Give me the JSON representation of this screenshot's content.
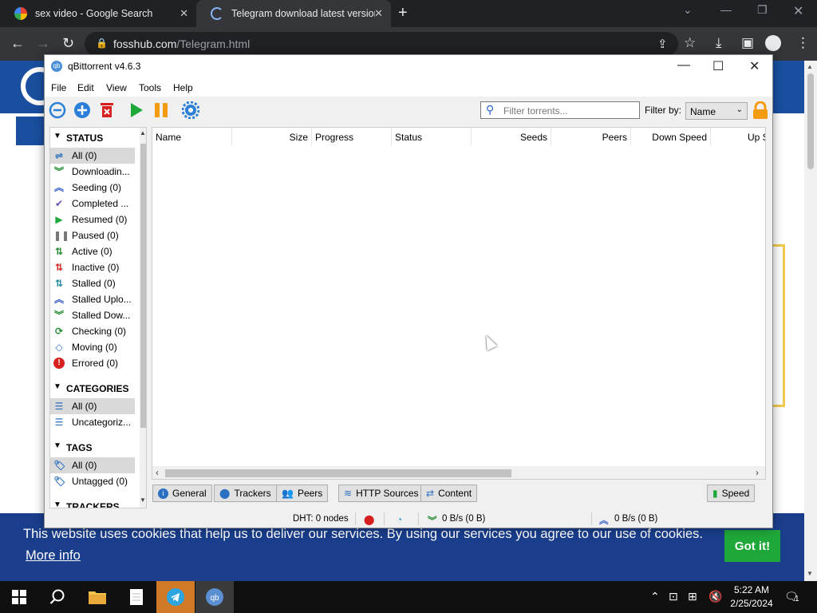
{
  "browser": {
    "tabs": [
      {
        "title": "sex video - Google Search",
        "favicon": "google-icon"
      },
      {
        "title": "Telegram download latest version",
        "favicon": "loading-icon"
      }
    ],
    "url_domain": "fosshub.com",
    "url_path": "/Telegram.html"
  },
  "webpage": {
    "cookie_message": "This website uses cookies that help us to deliver our services. By using our services you agree to our use of cookies.",
    "more_info": "More info",
    "got_it": "Got it!",
    "colors": {
      "header": "#1a4fa0",
      "banner": "#1a3e8c",
      "button": "#1fa83a"
    }
  },
  "qbittorrent": {
    "title": "qBittorrent v4.6.3",
    "menu": [
      "File",
      "Edit",
      "View",
      "Tools",
      "Help"
    ],
    "toolbar": {
      "buttons": [
        "add-link-icon",
        "add-torrent-icon",
        "delete-icon",
        "resume-icon",
        "pause-icon",
        "options-icon"
      ],
      "filter_placeholder": "Filter torrents...",
      "filter_by_label": "Filter by:",
      "filter_by_value": "Name"
    },
    "sidebar": {
      "status_header": "STATUS",
      "status_items": [
        {
          "label": "All (0)",
          "icon": "all-icon",
          "color": "#2b6fc2"
        },
        {
          "label": "Downloadin...",
          "icon": "downloading-icon",
          "color": "#1f8a2e"
        },
        {
          "label": "Seeding (0)",
          "icon": "seeding-icon",
          "color": "#3b63c7"
        },
        {
          "label": "Completed ...",
          "icon": "completed-icon",
          "color": "#6a4bb5"
        },
        {
          "label": "Resumed (0)",
          "icon": "resumed-icon",
          "color": "#1fa83a"
        },
        {
          "label": "Paused (0)",
          "icon": "paused-icon",
          "color": "#777777"
        },
        {
          "label": "Active (0)",
          "icon": "active-icon",
          "color": "#1f8a2e"
        },
        {
          "label": "Inactive (0)",
          "icon": "inactive-icon",
          "color": "#d62020"
        },
        {
          "label": "Stalled (0)",
          "icon": "stalled-icon",
          "color": "#1f8aa0"
        },
        {
          "label": "Stalled Uplo...",
          "icon": "stalled-upload-icon",
          "color": "#3b63c7"
        },
        {
          "label": "Stalled Dow...",
          "icon": "stalled-download-icon",
          "color": "#1f8a2e"
        },
        {
          "label": "Checking (0)",
          "icon": "checking-icon",
          "color": "#1f8a2e"
        },
        {
          "label": "Moving (0)",
          "icon": "moving-icon",
          "color": "#2b6fc2"
        },
        {
          "label": "Errored (0)",
          "icon": "errored-icon",
          "color": "#d62020"
        }
      ],
      "categories_header": "CATEGORIES",
      "category_items": [
        {
          "label": "All (0)",
          "icon": "list-icon"
        },
        {
          "label": "Uncategoriz...",
          "icon": "list-icon"
        }
      ],
      "tags_header": "TAGS",
      "tag_items": [
        {
          "label": "All (0)",
          "icon": "tag-icon"
        },
        {
          "label": "Untagged (0)",
          "icon": "tag-icon"
        }
      ],
      "trackers_header": "TRACKERS"
    },
    "columns": [
      "Name",
      "Size",
      "Progress",
      "Status",
      "Seeds",
      "Peers",
      "Down Speed",
      "Up S"
    ],
    "bottom_tabs": [
      "General",
      "Trackers",
      "Peers",
      "HTTP Sources",
      "Content"
    ],
    "speed_tab": "Speed",
    "statusbar": {
      "dht": "DHT: 0 nodes",
      "download": "0 B/s (0 B)",
      "upload": "0 B/s (0 B)"
    }
  },
  "taskbar": {
    "time": "5:22 AM",
    "date": "2/25/2024",
    "notifications": "1",
    "apps": [
      "start-icon",
      "search-icon",
      "file-explorer-icon",
      "notepad-icon",
      "telegram-icon",
      "qbittorrent-icon"
    ]
  }
}
